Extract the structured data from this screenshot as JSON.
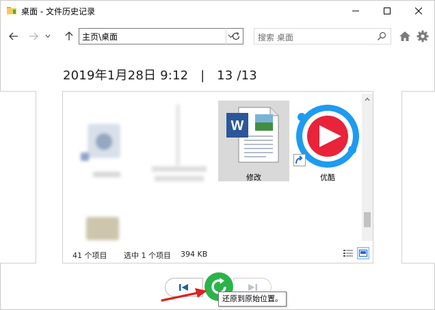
{
  "window": {
    "title": "桌面 - 文件历史记录"
  },
  "nav": {
    "address": "主页\\桌面",
    "search_placeholder": "搜索 桌面"
  },
  "heading": {
    "date": "2019年1月28日 9:12",
    "separator": "|",
    "position": "13 /13"
  },
  "files": [
    {
      "name": "",
      "blurred": true
    },
    {
      "name": "",
      "blurred": true
    },
    {
      "name": "修改",
      "icon": "word-document-icon",
      "selected": true
    },
    {
      "name": "优酷",
      "icon": "youku-shortcut-icon",
      "shortcut": true
    },
    {
      "name": "",
      "blurred": true
    }
  ],
  "status": {
    "item_count": "41 个项目",
    "selection": "选中 1 个项目",
    "size": "394 KB"
  },
  "controls": {
    "tooltip": "还原到原始位置。"
  },
  "colors": {
    "restore_green": "#2bb34a",
    "arrow_red": "#e02020",
    "word_blue": "#2b579a",
    "youku_blue": "#1e9bf0",
    "youku_red": "#e8233a",
    "nav_blue": "#0063b1"
  }
}
